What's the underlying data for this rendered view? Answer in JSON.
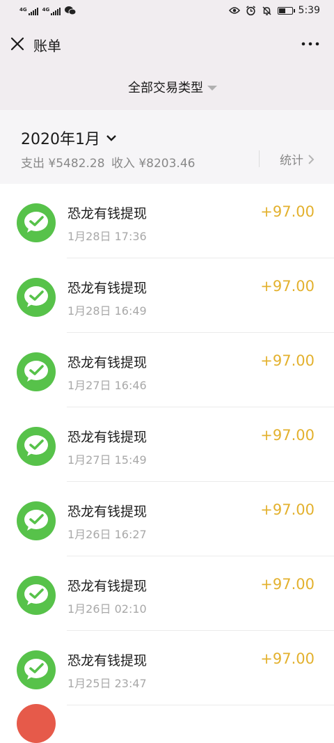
{
  "status_bar": {
    "signal_tags": [
      "4G",
      "4G"
    ],
    "time": "5:39",
    "battery_level": 0.55
  },
  "nav": {
    "title": "账单",
    "icons": {
      "close": "close-icon",
      "more": "more-icon"
    }
  },
  "filter": {
    "label": "全部交易类型",
    "icon": "caret-down-icon"
  },
  "month": {
    "label": "2020年1月",
    "summary_expense": "支出 ¥5482.28",
    "summary_income": "收入 ¥8203.46",
    "stats_label": "统计"
  },
  "colors": {
    "app_green": "#57c24a",
    "amount_gold": "#e3b12e",
    "header_bg": "#f1edf0"
  },
  "transactions": [
    {
      "title": "恐龙有钱提现",
      "time": "1月28日 17:36",
      "amount": "+97.00"
    },
    {
      "title": "恐龙有钱提现",
      "time": "1月28日 16:49",
      "amount": "+97.00"
    },
    {
      "title": "恐龙有钱提现",
      "time": "1月27日 16:46",
      "amount": "+97.00"
    },
    {
      "title": "恐龙有钱提现",
      "time": "1月27日 15:49",
      "amount": "+97.00"
    },
    {
      "title": "恐龙有钱提现",
      "time": "1月26日 16:27",
      "amount": "+97.00"
    },
    {
      "title": "恐龙有钱提现",
      "time": "1月26日 02:10",
      "amount": "+97.00"
    },
    {
      "title": "恐龙有钱提现",
      "time": "1月25日 23:47",
      "amount": "+97.00"
    }
  ]
}
